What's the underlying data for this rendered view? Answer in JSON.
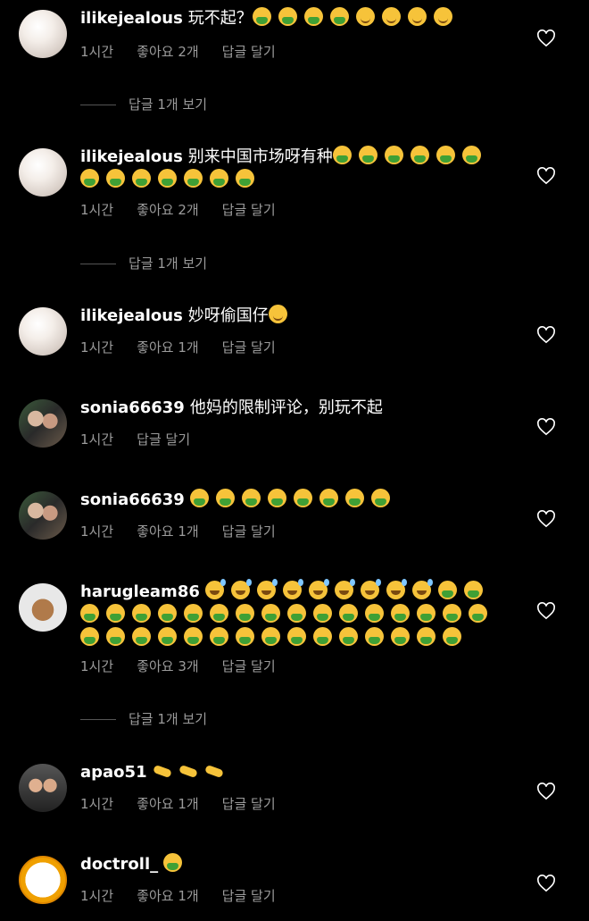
{
  "comments": [
    {
      "user": "ilikejealous",
      "text": "玩不起？",
      "emojis": [
        "sick",
        "sick",
        "sick",
        "sick",
        "smile",
        "smile",
        "smile",
        "smile"
      ],
      "time": "1시간",
      "likes": "좋아요 2개",
      "reply": "답글 달기",
      "view_replies": "답글 1개 보기"
    },
    {
      "user": "ilikejealous",
      "text": "别来中国市场呀有种",
      "emojis": [
        "sick",
        "sick",
        "sick",
        "sick",
        "sick",
        "sick",
        "sick",
        "sick",
        "sick",
        "sick",
        "sick",
        "sick",
        "sick"
      ],
      "time": "1시간",
      "likes": "좋아요 2개",
      "reply": "답글 달기",
      "view_replies": "답글 1개 보기"
    },
    {
      "user": "ilikejealous",
      "text": "妙呀偷国仔",
      "emojis": [
        "smile"
      ],
      "time": "1시간",
      "likes": "좋아요 1개",
      "reply": "답글 달기"
    },
    {
      "user": "sonia66639",
      "text": "他妈的限制评论，别玩不起",
      "emojis": [],
      "time": "1시간",
      "reply": "답글 달기"
    },
    {
      "user": "sonia66639",
      "text": "",
      "emojis": [
        "sick",
        "sick",
        "sick",
        "sick",
        "sick",
        "sick",
        "sick",
        "sick"
      ],
      "time": "1시간",
      "likes": "좋아요 1개",
      "reply": "답글 달기"
    },
    {
      "user": "harugleam86",
      "text": "",
      "emojis": [
        "sweat",
        "sweat",
        "sweat",
        "sweat",
        "sweat",
        "sweat",
        "sweat",
        "sweat",
        "sweat",
        "sick",
        "sick",
        "sick",
        "sick",
        "sick",
        "sick",
        "sick",
        "sick",
        "sick",
        "sick",
        "sick",
        "sick",
        "sick",
        "sick",
        "sick",
        "sick",
        "sick",
        "sick",
        "sick",
        "sick",
        "sick",
        "sick",
        "sick",
        "sick",
        "sick",
        "sick",
        "sick",
        "sick",
        "sick",
        "sick",
        "sick",
        "sick",
        "sick"
      ],
      "time": "1시간",
      "likes": "좋아요 3개",
      "reply": "답글 달기",
      "view_replies": "답글 1개 보기"
    },
    {
      "user": "apao51",
      "text": "",
      "emojis": [
        "hand",
        "hand",
        "hand"
      ],
      "time": "1시간",
      "likes": "좋아요 1개",
      "reply": "답글 달기"
    },
    {
      "user": "doctroll_",
      "text": "",
      "emojis": [
        "sick"
      ],
      "time": "1시간",
      "likes": "좋아요 1개",
      "reply": "답글 달기"
    }
  ],
  "icons": {
    "like": "heart-outline-icon"
  },
  "colors": {
    "background": "#000000",
    "text": "#ffffff",
    "muted": "#9b9b9b"
  }
}
